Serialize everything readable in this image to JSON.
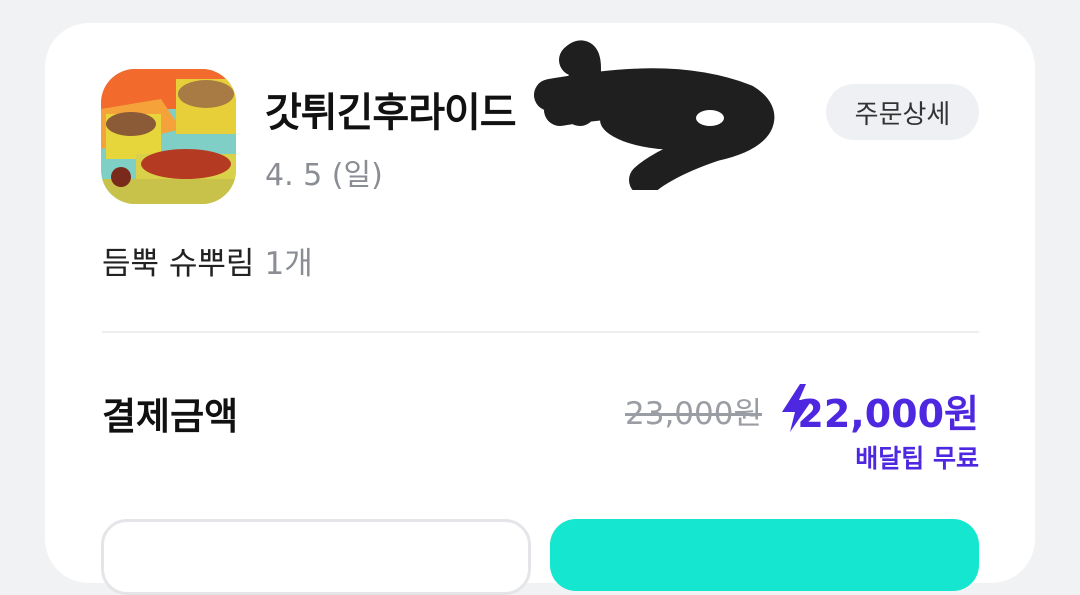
{
  "order": {
    "store_name": "갓튀긴후라이드",
    "date": "4. 5 (일)",
    "detail_button": "주문상세",
    "menu_item": "듬뿍 슈뿌림",
    "menu_qty": "1개"
  },
  "payment": {
    "label": "결제금액",
    "original_price": "23,000원",
    "final_price": "22,000원",
    "delivery_note": "배달팁 무료"
  },
  "colors": {
    "accent": "#4e28e0",
    "cta": "#14e6cf"
  },
  "icons": {
    "lightning": "lightning-icon"
  }
}
